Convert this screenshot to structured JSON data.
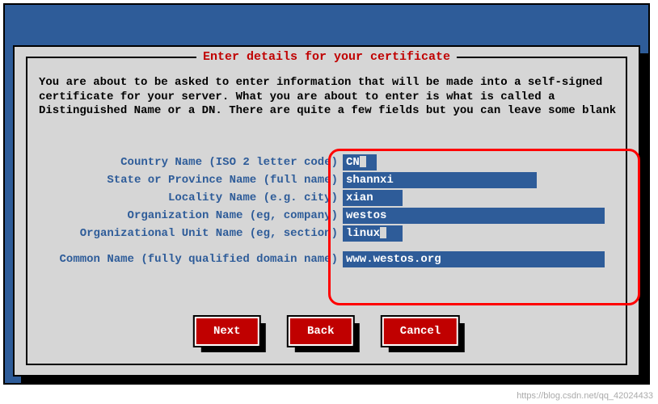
{
  "dialog": {
    "title": "Enter details for your certificate",
    "intro": "You are about to be asked to enter information that will be made into a self-signed certificate for your server. What you are about to enter is what is called a Distinguished Name or a DN.  There are quite a few fields but you can leave some blank"
  },
  "fields": {
    "country": {
      "label": "Country Name (ISO 2 letter code)",
      "value": "CN"
    },
    "state": {
      "label": "State or Province Name (full name)",
      "value": "shannxi"
    },
    "locality": {
      "label": "Locality Name (e.g. city)",
      "value": "xian"
    },
    "org": {
      "label": "Organization Name (eg, company)",
      "value": "westos"
    },
    "ou": {
      "label": "Organizational Unit Name (eg, section)",
      "value": "linux"
    },
    "cn": {
      "label": "Common Name (fully qualified domain name)",
      "value": "www.westos.org"
    }
  },
  "buttons": {
    "next": "Next",
    "back": "Back",
    "cancel": "Cancel"
  },
  "watermark": "https://blog.csdn.net/qq_42024433"
}
